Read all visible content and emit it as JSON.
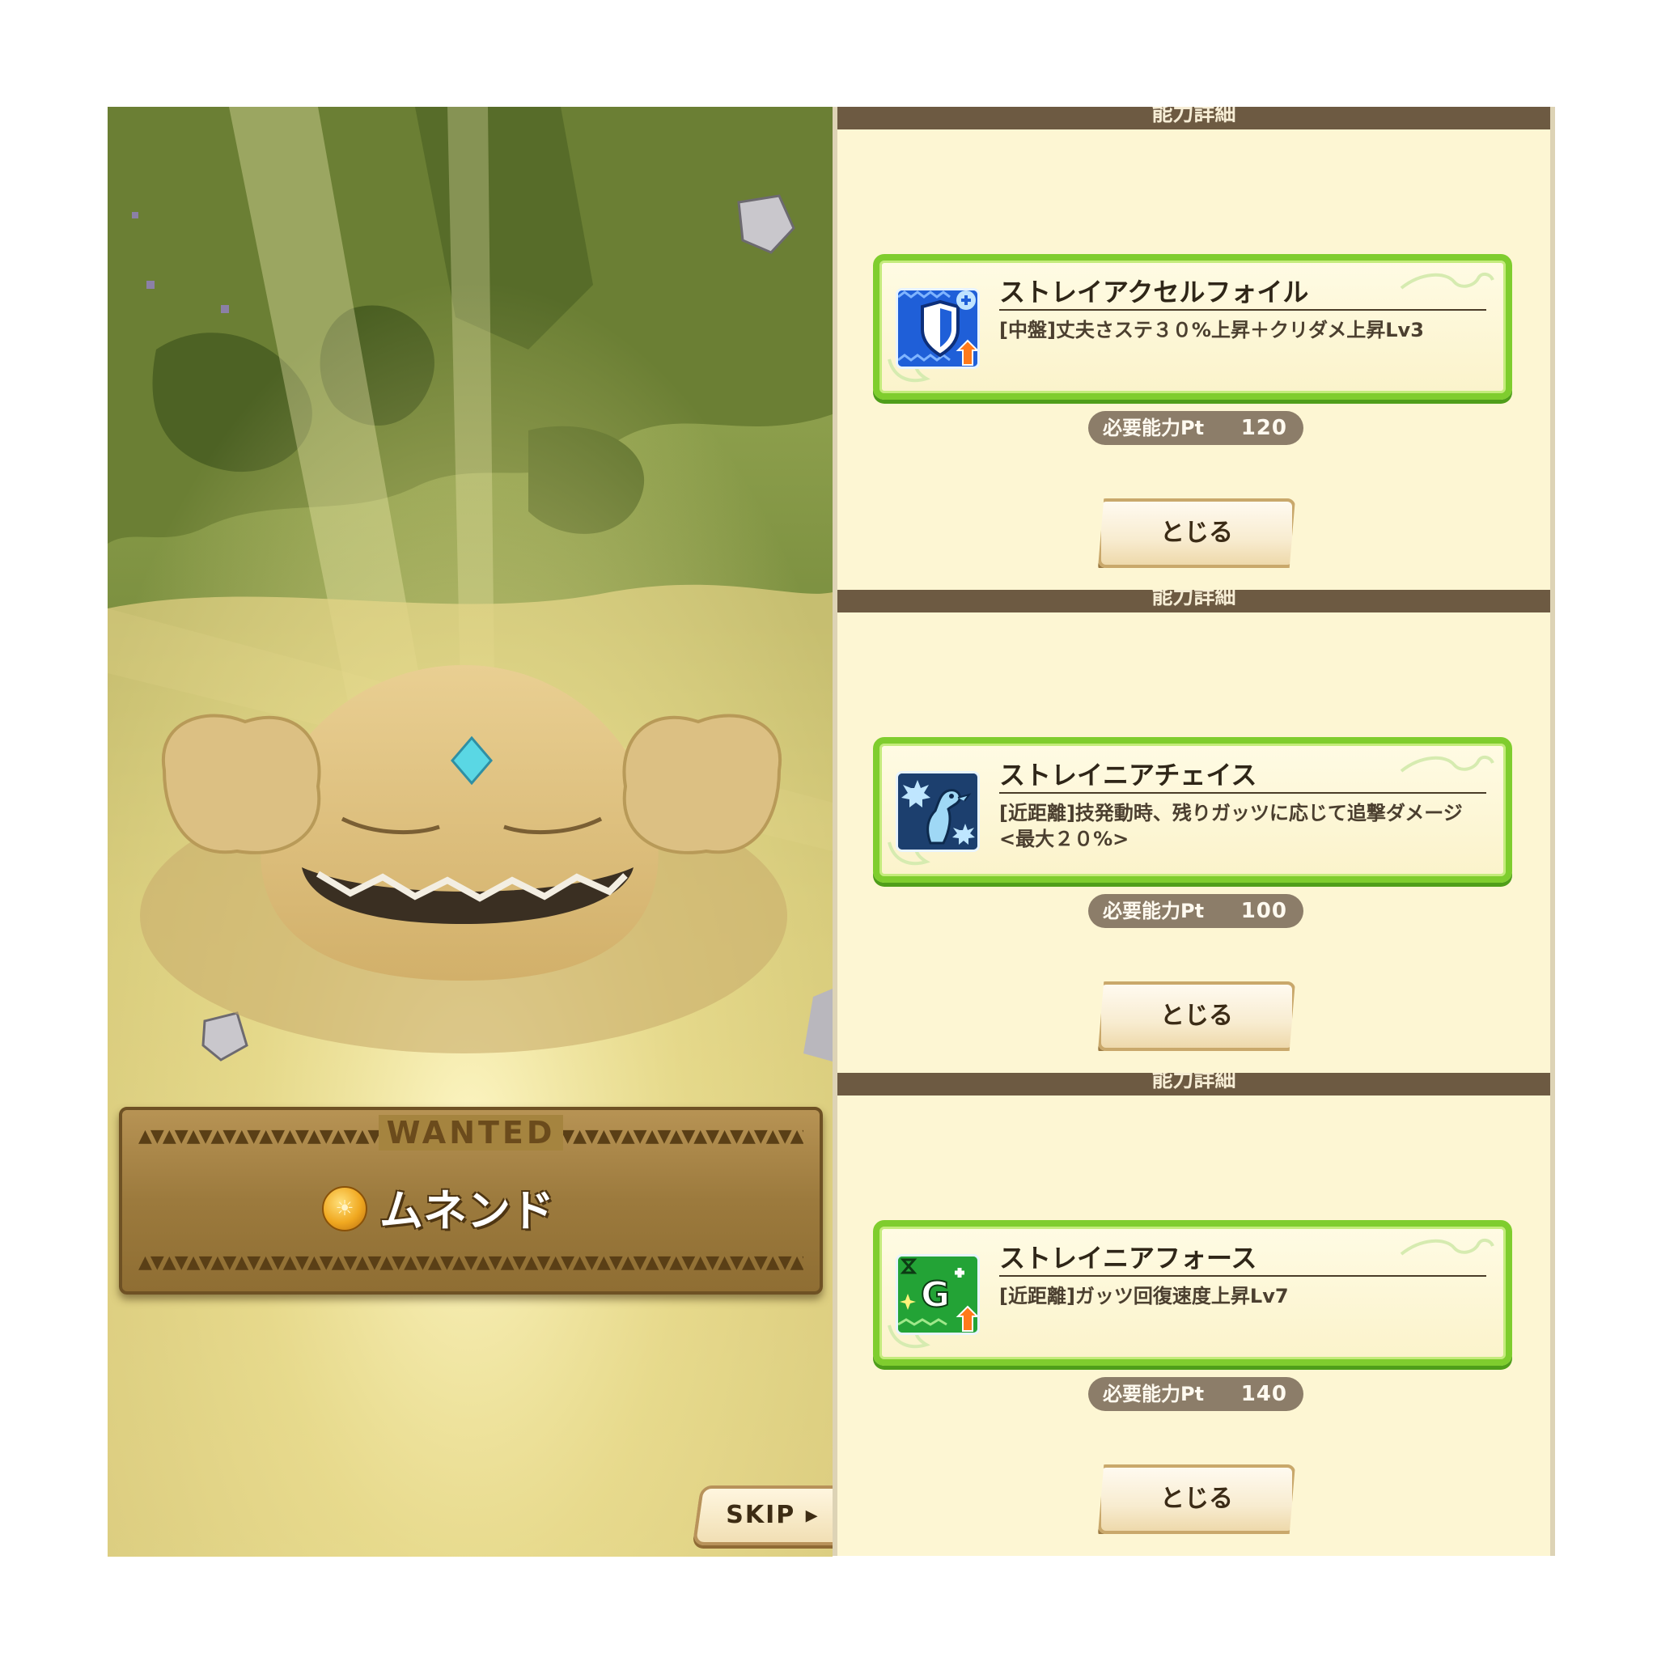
{
  "scene": {
    "wanted_label": "WANTED",
    "trim_pattern": "▲▼▲▼▲▼▲▼▲▼▲▼▲▼▲▼▲▼▲▼▲▼▲▼▲▼▲▼▲▼▲▼▲▼▲▼▲▼▲▼▲▼▲▼▲▼▲▼▲▼▲▼▲▼▲▼▲▼",
    "monster_name": "ムネンド",
    "coin_glyph": "☀",
    "skip_label": "SKIP ▸"
  },
  "panels": [
    {
      "header": "能力詳細",
      "icon": "shield-plus-icon",
      "icon_color": "#1f5fd8",
      "name": "ストレイアクセルフォイル",
      "desc": "[中盤]丈夫さステ３０%上昇＋クリダメ上昇Lv3",
      "pt_label": "必要能力Pt",
      "pt_value": "120",
      "close_label": "とじる"
    },
    {
      "header": "能力詳細",
      "icon": "chase-bird-icon",
      "icon_color": "#1c3f6e",
      "name": "ストレイニアチェイス",
      "desc": "[近距離]技発動時、残りガッツに応じて追撃ダメージ\n<最大２０%>",
      "pt_label": "必要能力Pt",
      "pt_value": "100",
      "close_label": "とじる"
    },
    {
      "header": "能力詳細",
      "icon": "guts-plus-icon",
      "icon_color": "#23a336",
      "name": "ストレイニアフォース",
      "desc": "[近距離]ガッツ回復速度上昇Lv7",
      "pt_label": "必要能力Pt",
      "pt_value": "140",
      "close_label": "とじる"
    }
  ],
  "colors": {
    "card_border": "#7fcd2e",
    "panel_bg": "#fdf6d3",
    "pill_bg": "#8c7d69",
    "wanted_wood": "#9c7a3d"
  }
}
